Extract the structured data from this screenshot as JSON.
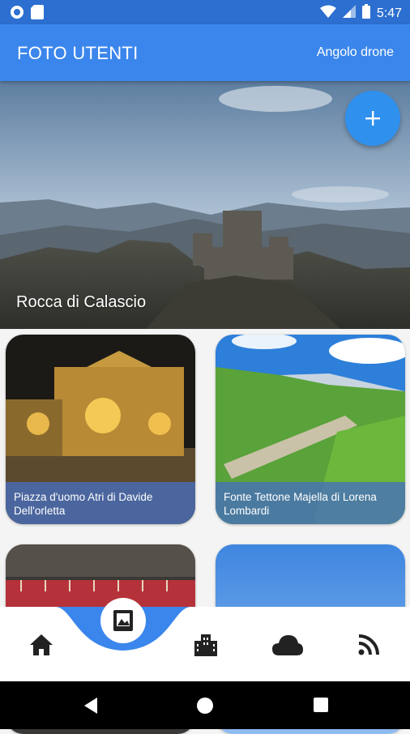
{
  "status_bar": {
    "time": "5:47"
  },
  "app_bar": {
    "title": "FOTO UTENTI",
    "action_label": "Angolo drone"
  },
  "hero": {
    "caption": "Rocca di Calascio"
  },
  "photos": [
    {
      "caption": "Piazza d'uomo Atri di Davide Dell'orletta"
    },
    {
      "caption": "Fonte Tettone Majella di Lorena Lombardi"
    },
    {
      "caption": ""
    },
    {
      "caption": ""
    }
  ],
  "bottom_nav": {
    "items": [
      "home-icon",
      "photo-gallery-icon",
      "city-icon",
      "cloud-icon",
      "rss-feed-icon"
    ],
    "active": "photo-gallery-icon",
    "accent": "#3b86ec"
  },
  "colors": {
    "app_bar": "#3b86ec",
    "status_bar": "#2c6fd0",
    "fab": "#2f90ee"
  }
}
